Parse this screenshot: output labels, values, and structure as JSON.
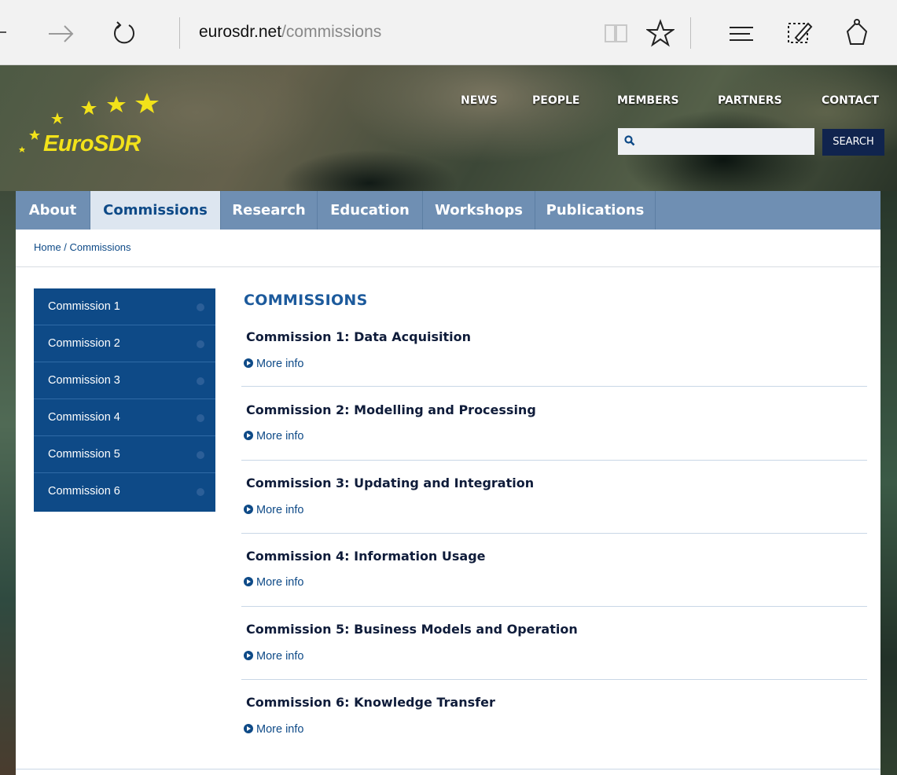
{
  "browser": {
    "url_host": "eurosdr.net",
    "url_path": "/commissions"
  },
  "brand": {
    "logo_text": "EuroSDR",
    "accent": "#f2e21a"
  },
  "top_nav": [
    "NEWS",
    "PEOPLE",
    "MEMBERS",
    "PARTNERS",
    "CONTACT"
  ],
  "search": {
    "placeholder": "",
    "button": "SEARCH"
  },
  "main_nav": [
    {
      "label": "About",
      "active": false
    },
    {
      "label": "Commissions",
      "active": true
    },
    {
      "label": "Research",
      "active": false
    },
    {
      "label": "Education",
      "active": false
    },
    {
      "label": "Workshops",
      "active": false
    },
    {
      "label": "Publications",
      "active": false
    }
  ],
  "breadcrumb": "Home / Commissions",
  "sidebar": [
    "Commission 1",
    "Commission 2",
    "Commission 3",
    "Commission 4",
    "Commission 5",
    "Commission 6"
  ],
  "content": {
    "heading": "COMMISSIONS",
    "more_label": "More info",
    "items": [
      "Commission 1: Data Acquisition",
      "Commission 2: Modelling and Processing",
      "Commission 3: Updating and Integration",
      "Commission 4: Information Usage",
      "Commission 5: Business Models and Operation",
      "Commission 6: Knowledge Transfer"
    ]
  },
  "colors": {
    "nav_bg": "#6f8fb3",
    "nav_active_bg": "#dde6f0",
    "primary": "#0e4a87",
    "search_button": "#10244e"
  }
}
